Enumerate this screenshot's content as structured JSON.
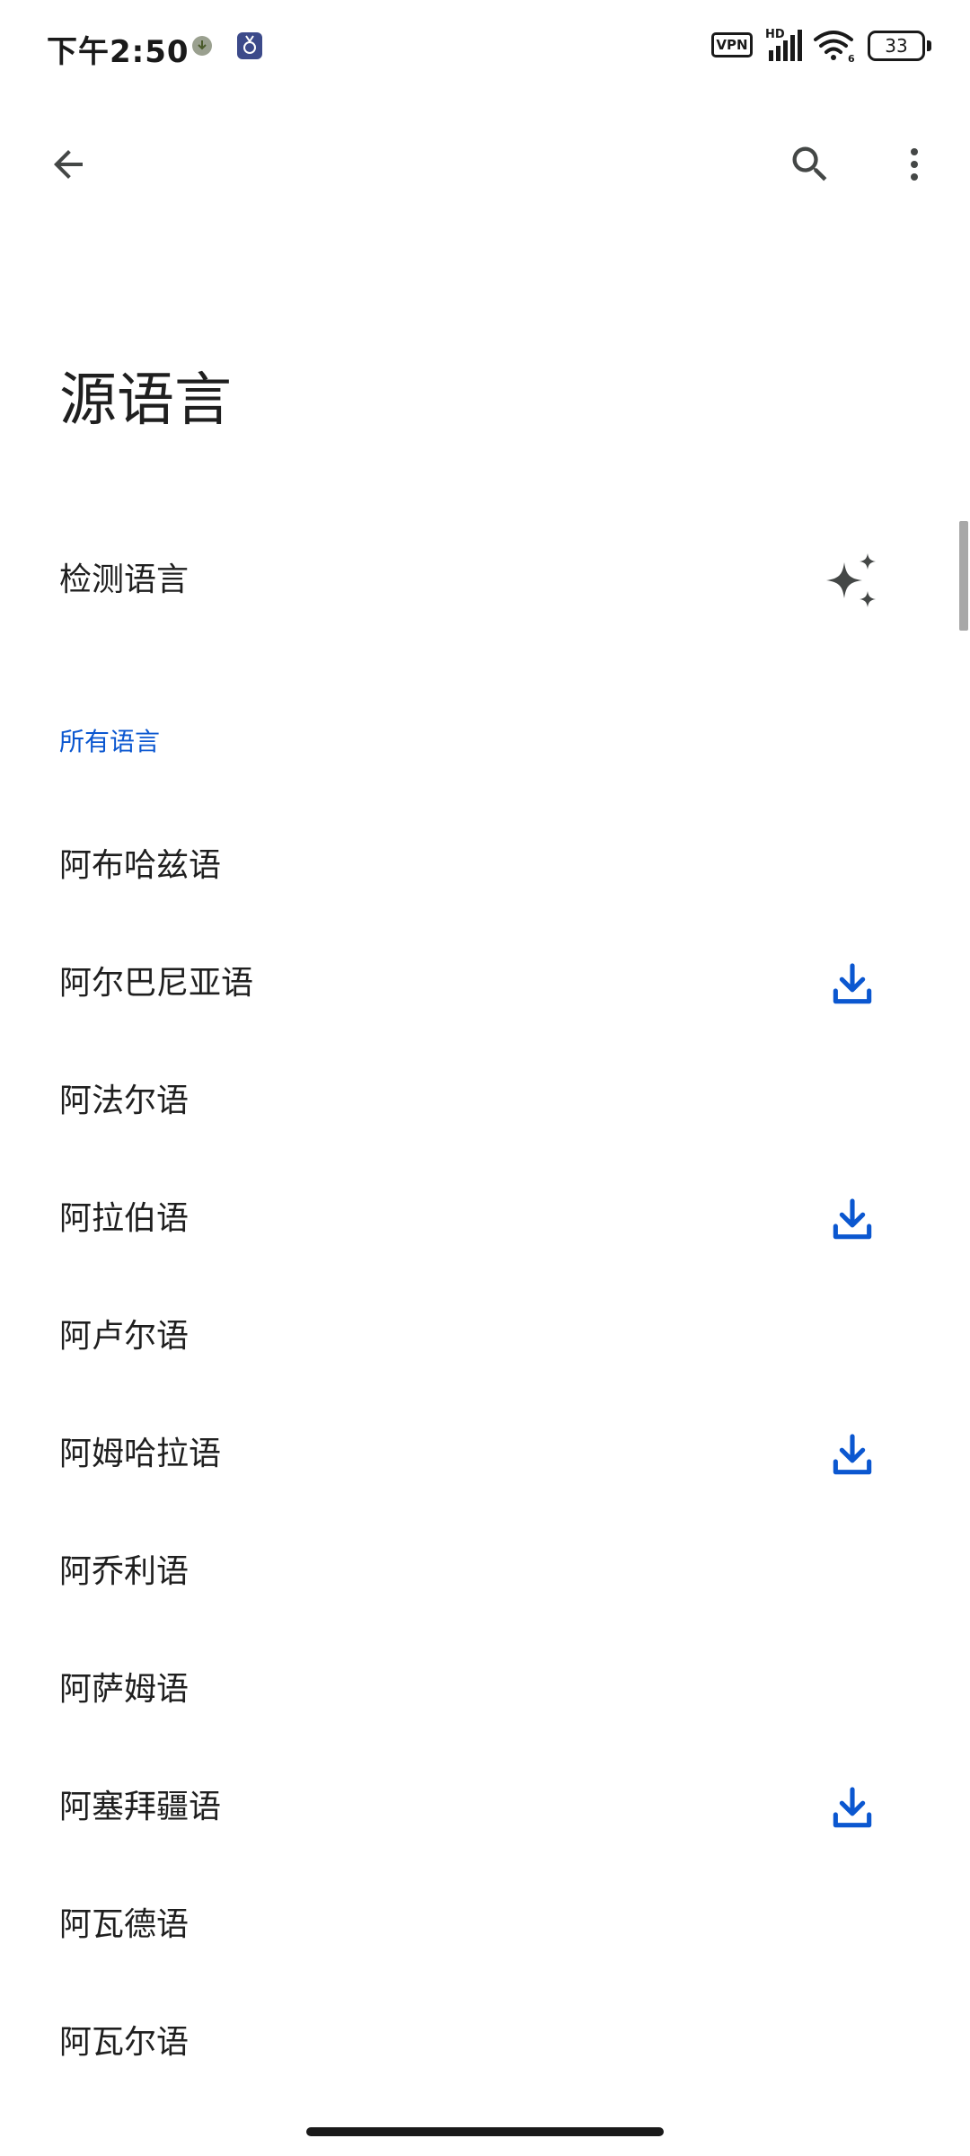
{
  "status_bar": {
    "time": "下午2:50",
    "vpn_label": "VPN",
    "network_label": "HD",
    "wifi_label": "6",
    "battery": "33"
  },
  "app_bar": {
    "back_icon": "arrow-back-icon",
    "search_icon": "search-icon",
    "more_icon": "more-vert-icon"
  },
  "page": {
    "title": "源语言",
    "detect_label": "检测语言",
    "detect_icon": "sparkle-icon",
    "section_header": "所有语言"
  },
  "languages": [
    {
      "label": "阿布哈兹语",
      "downloadable": false
    },
    {
      "label": "阿尔巴尼亚语",
      "downloadable": true
    },
    {
      "label": "阿法尔语",
      "downloadable": false
    },
    {
      "label": "阿拉伯语",
      "downloadable": true
    },
    {
      "label": "阿卢尔语",
      "downloadable": false
    },
    {
      "label": "阿姆哈拉语",
      "downloadable": true
    },
    {
      "label": "阿乔利语",
      "downloadable": false
    },
    {
      "label": "阿萨姆语",
      "downloadable": false
    },
    {
      "label": "阿塞拜疆语",
      "downloadable": true
    },
    {
      "label": "阿瓦德语",
      "downloadable": false
    },
    {
      "label": "阿瓦尔语",
      "downloadable": false
    }
  ],
  "colors": {
    "accent": "#0b57d0",
    "text": "#1f1f1f",
    "icon": "#444746"
  }
}
